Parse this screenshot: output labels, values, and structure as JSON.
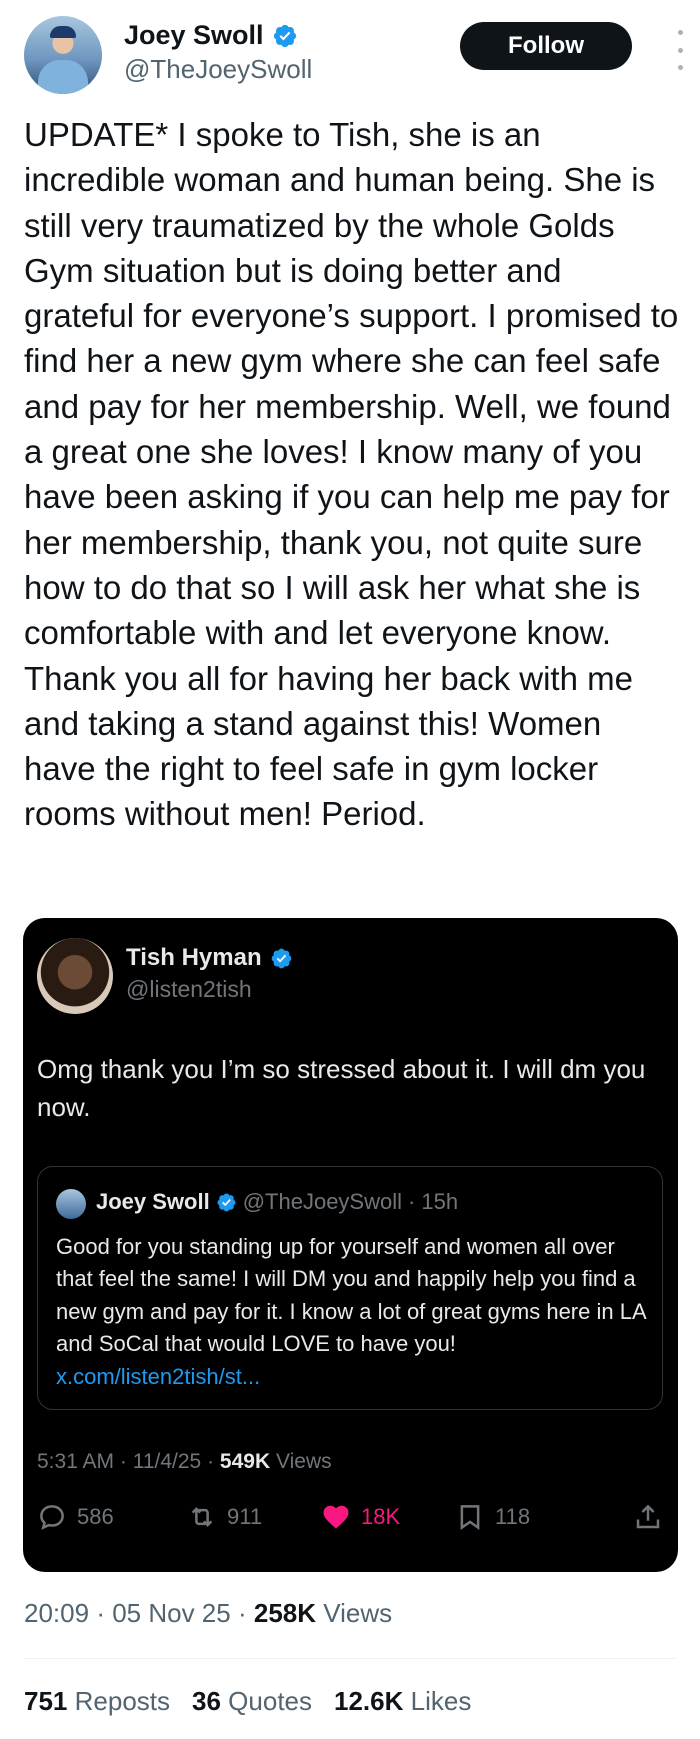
{
  "tweet": {
    "author": {
      "display_name": "Joey Swoll",
      "handle": "@TheJoeySwoll",
      "verified_icon": "verified-badge-icon"
    },
    "follow_label": "Follow",
    "text": "UPDATE* I spoke to Tish, she is an incredible woman and human being. She is still very traumatized by the whole Golds Gym situation but is doing better and grateful for everyone’s support. I promised to find her a new gym where she can feel safe and pay for her membership. Well, we found a great one she loves! I know many of you have been asking if you can help me pay for her membership, thank you, not quite sure how to do that so I will ask her what she is comfortable with and let everyone know. Thank you all for having her back with me and taking a stand against this! Women have the right to feel safe in gym locker rooms without men! Period.",
    "time": "20:09",
    "date": "05 Nov 25",
    "views_count": "258K",
    "views_label": "Views",
    "stats": {
      "reposts_count": "751",
      "reposts_label": "Reposts",
      "quotes_count": "36",
      "quotes_label": "Quotes",
      "likes_count": "12.6K",
      "likes_label": "Likes"
    }
  },
  "quoted": {
    "author": {
      "display_name": "Tish Hyman",
      "handle": "@listen2tish"
    },
    "text": "Omg thank you I’m so stressed about it. I will dm you now.",
    "inner": {
      "display_name": "Joey Swoll",
      "handle": "@TheJoeySwoll",
      "age": "15h",
      "text": "Good for you standing up for yourself and women all over that feel the same! I will DM you and happily help  you find a new gym and pay for it. I know a lot of great gyms here in LA and SoCal that would LOVE to have you! ",
      "link": "x.com/listen2tish/st..."
    },
    "time": "5:31 AM",
    "date": "11/4/25",
    "views_count": "549K",
    "views_label": "Views",
    "actions": {
      "replies": "586",
      "reposts": "911",
      "likes": "18K",
      "bookmarks": "118"
    }
  },
  "colors": {
    "accent": "#1d9bf0",
    "like": "#f91880",
    "muted": "#536471"
  }
}
